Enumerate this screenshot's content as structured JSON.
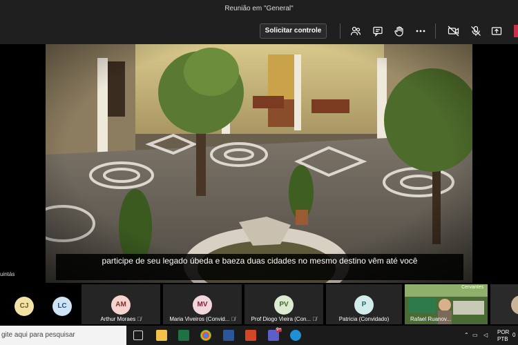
{
  "window": {
    "title": "Reunião em \"General\""
  },
  "toolbar": {
    "request_control_label": "Solicitar controle",
    "icons": [
      "people-icon",
      "chat-icon",
      "raise-hand-icon",
      "more-icon",
      "camera-off-icon",
      "mic-off-icon",
      "share-tray-icon"
    ],
    "accent": "#c4314b"
  },
  "video": {
    "caption": "participe de seu legado úbeda e baeza duas cidades no mesmo destino vêm até você"
  },
  "side_participant": {
    "name": "uintás"
  },
  "participants": [
    {
      "initials": "CJ",
      "name": "",
      "bg": "#f2e2a8",
      "fg": "#6e5a12"
    },
    {
      "initials": "LC",
      "name": "",
      "bg": "#cfe4f5",
      "fg": "#1f4f7a"
    },
    {
      "initials": "AM",
      "name": "Arthur Moraes",
      "bg": "#f5d3cf",
      "fg": "#8a2c22"
    },
    {
      "initials": "MV",
      "name": "Maria Viveiros (Convid...",
      "bg": "#f2d6dc",
      "fg": "#7a2138"
    },
    {
      "initials": "PV",
      "name": "Prof Diogo Vieira (Con...",
      "bg": "#dcead2",
      "fg": "#3f6a27"
    },
    {
      "initials": "P",
      "name": "Patricia (Convidado)",
      "bg": "#d2ecec",
      "fg": "#1f6a6a"
    }
  ],
  "video_tile": {
    "name": "Rafael Ruanov...",
    "overlay_text": "Cervantes"
  },
  "taskbar": {
    "search_placeholder": "gite aqui para pesquisar",
    "language": "POR",
    "layout": "PTB",
    "time": "0",
    "badge": "9+"
  }
}
